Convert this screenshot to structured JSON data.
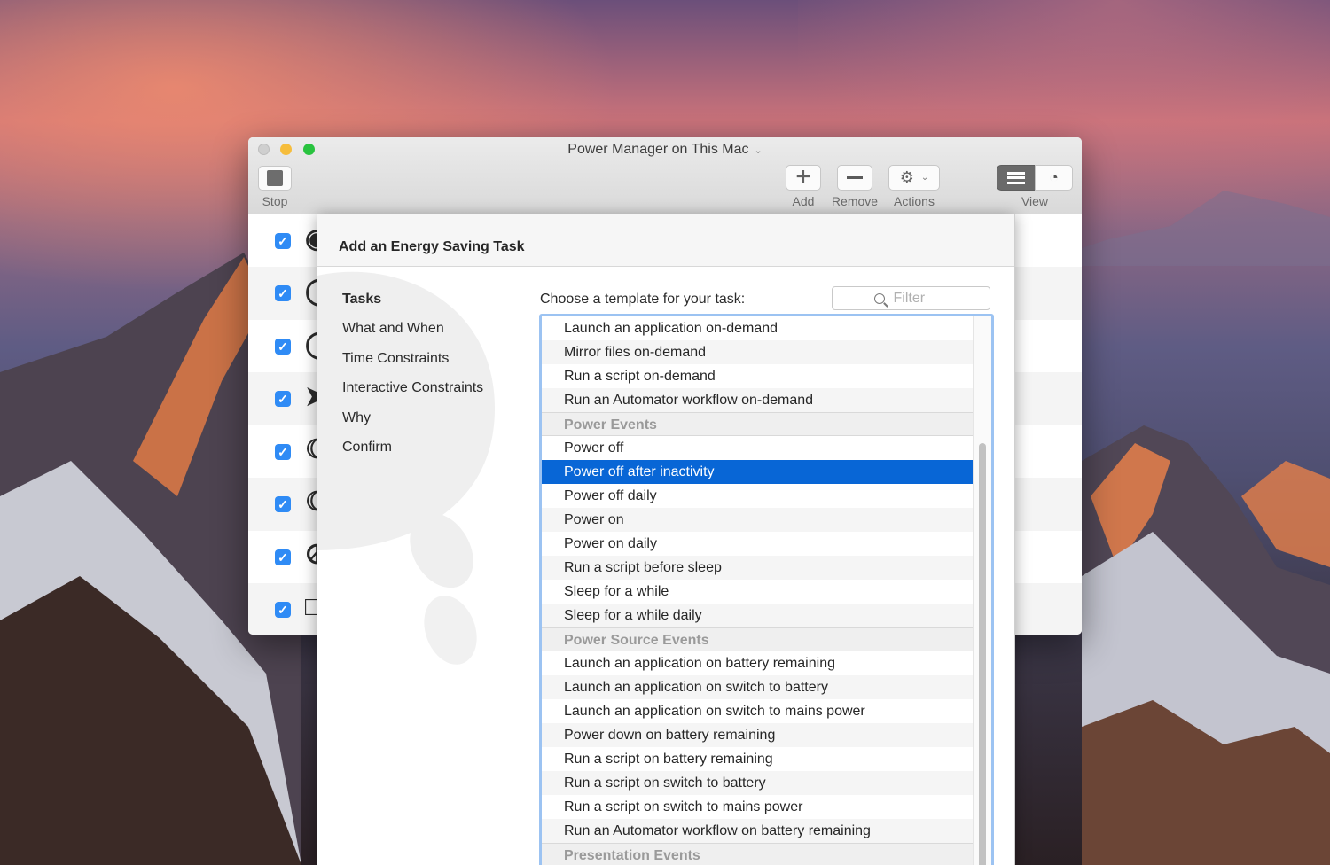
{
  "window": {
    "title": "Power Manager on This Mac",
    "toolbar": {
      "stop_label": "Stop",
      "add_label": "Add",
      "remove_label": "Remove",
      "actions_label": "Actions",
      "view_label": "View"
    }
  },
  "sheet": {
    "title": "Add an Energy Saving Task",
    "nav": [
      {
        "label": "Tasks",
        "active": true
      },
      {
        "label": "What and When"
      },
      {
        "label": "Time Constraints"
      },
      {
        "label": "Interactive Constraints"
      },
      {
        "label": "Why"
      },
      {
        "label": "Confirm"
      }
    ],
    "prompt": "Choose a template for your task:",
    "filter_placeholder": "Filter",
    "templates": [
      {
        "label": "Launch an application on-demand"
      },
      {
        "label": "Mirror files on-demand"
      },
      {
        "label": "Run a script on-demand"
      },
      {
        "label": "Run an Automator workflow on-demand"
      },
      {
        "label": "Power Events",
        "group": true
      },
      {
        "label": "Power off"
      },
      {
        "label": "Power off after inactivity",
        "selected": true
      },
      {
        "label": "Power off daily"
      },
      {
        "label": "Power on"
      },
      {
        "label": "Power on daily"
      },
      {
        "label": "Run a script before sleep"
      },
      {
        "label": "Sleep for a while"
      },
      {
        "label": "Sleep for a while daily"
      },
      {
        "label": "Power Source Events",
        "group": true
      },
      {
        "label": "Launch an application on battery remaining"
      },
      {
        "label": "Launch an application on switch to battery"
      },
      {
        "label": "Launch an application on switch to mains power"
      },
      {
        "label": "Power down on battery remaining"
      },
      {
        "label": "Run a script on battery remaining"
      },
      {
        "label": "Run a script on switch to battery"
      },
      {
        "label": "Run a script on switch to mains power"
      },
      {
        "label": "Run an Automator workflow on battery remaining"
      },
      {
        "label": "Presentation Events",
        "group": true
      }
    ]
  },
  "colors": {
    "selection": "#0866d6",
    "checkbox": "#2f8bf5",
    "focus_ring": "#9cc3f2"
  }
}
